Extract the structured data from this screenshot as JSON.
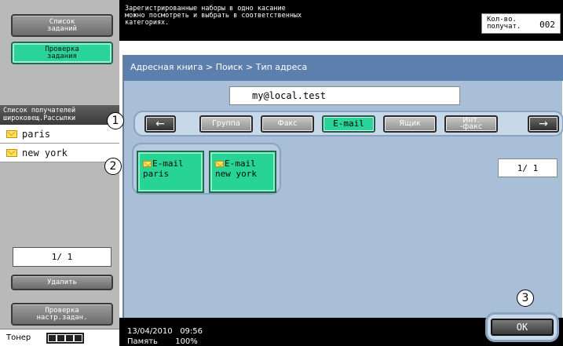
{
  "sidebar": {
    "job_list_label": "Список\nзаданий",
    "job_check_label": "Проверка\nзадания",
    "recipients_header": "Список получателей\nшироковещ.Рассылки",
    "recipients": [
      {
        "name": "paris",
        "icon": "envelope-icon"
      },
      {
        "name": "new york",
        "icon": "envelope-icon"
      }
    ],
    "page_indicator": "1/  1",
    "delete_label": "Удалить",
    "check_settings_label": "Проверка\nнастр.задан.",
    "toner_label": "Тонер",
    "toner_level": 1.0
  },
  "top": {
    "message": "Зарегистрированные наборы в одно касание\nможно посмотреть и выбрать в соответственных\nкатегориях.",
    "count_label": "Кол-во.\nполучат.",
    "count_value": "002"
  },
  "main": {
    "breadcrumb": "Адресная книга > Поиск > Тип адреса",
    "address_value": "my@local.test",
    "categories": [
      {
        "label": "←",
        "icon": "arrow-left-icon"
      },
      {
        "label": "Группа"
      },
      {
        "label": "Факс"
      },
      {
        "label": "E-mail",
        "active": true
      },
      {
        "label": "Ящик"
      },
      {
        "label": "Инт.\n-факс"
      },
      {
        "label": "→",
        "icon": "arrow-right-icon"
      }
    ],
    "entries": [
      {
        "type": "E-mail",
        "name": "paris"
      },
      {
        "type": "E-mail",
        "name": "new york"
      }
    ],
    "page_indicator": "1/  1",
    "ok_label": "OK"
  },
  "callouts": [
    "1",
    "2",
    "3"
  ],
  "status": {
    "date": "13/04/2010",
    "time": "09:56",
    "memory_label": "Память",
    "memory_value": "100%"
  },
  "colors": {
    "accent_green": "#2ad39a",
    "panel_blue": "#a8bfd7",
    "header_blue": "#5c7fad"
  }
}
